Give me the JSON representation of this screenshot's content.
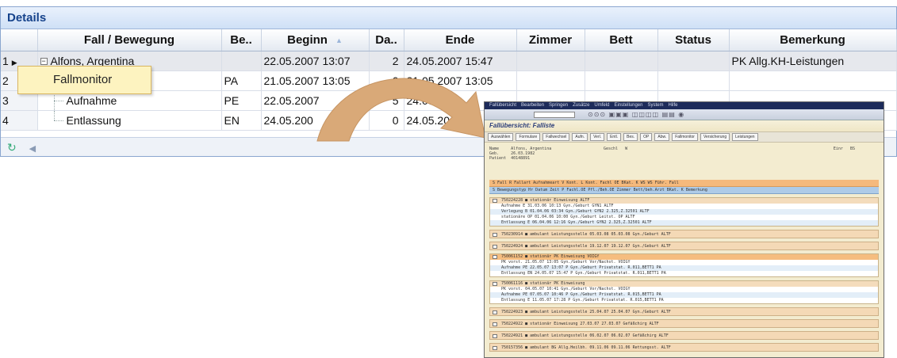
{
  "panel": {
    "title": "Details"
  },
  "columns": {
    "fall": "Fall / Bewegung",
    "be": "Be..",
    "beginn": "Beginn",
    "da": "Da..",
    "ende": "Ende",
    "zimmer": "Zimmer",
    "bett": "Bett",
    "status": "Status",
    "bemerkung": "Bemerkung"
  },
  "rows": [
    {
      "num": "1",
      "fall": "Alfons, Argentina",
      "be": "",
      "beginn": "22.05.2007 13:07",
      "da": "2",
      "ende": "24.05.2007 15:47",
      "zimmer": "",
      "bett": "",
      "status": "",
      "bemerkung": "PK Allg.KH-Leistungen"
    },
    {
      "num": "2",
      "fall": "",
      "be": "PA",
      "beginn": "21.05.2007 13:05",
      "da": "0",
      "ende": "21.05.2007 13:05",
      "zimmer": "",
      "bett": "",
      "status": "",
      "bemerkung": ""
    },
    {
      "num": "3",
      "fall": "Aufnahme",
      "be": "PE",
      "beginn": "22.05.2007",
      "da": "5",
      "ende": "24.05.2",
      "zimmer": "",
      "bett": "",
      "status": "",
      "bemerkung": ""
    },
    {
      "num": "4",
      "fall": "Entlassung",
      "be": "EN",
      "beginn": "24.05.200",
      "da": "0",
      "ende": "24.05.20",
      "zimmer": "",
      "bett": "",
      "status": "",
      "bemerkung": ""
    }
  ],
  "popup": {
    "label": "Fallmonitor"
  },
  "colors": {
    "accent": "#15428b",
    "popup": "#fdf3c0",
    "arrow": "#d9a978",
    "sap_orange": "#f5b97c"
  },
  "sap": {
    "menu": [
      "Fallübersicht",
      "Bearbeiten",
      "Springen",
      "Zusätze",
      "Umfeld",
      "Einstellungen",
      "System",
      "Hilfe"
    ],
    "title": "Fallübersicht: Falliste",
    "toolbar": [
      "Auswählen",
      "Formulare",
      "Fallwechsel",
      "Aufn.",
      "Verl.",
      "Entl.",
      "Bes.",
      "OP",
      "Abw.",
      "Fallmonitor",
      "Versicherung",
      "Leistungen"
    ],
    "header": {
      "name_label": "Name",
      "name": "Alfons, Argentina",
      "geb_label": "Geb.",
      "geb": "26.03.1982",
      "patient_label": "Patient",
      "patient": "40148891",
      "geschl_label": "Geschl",
      "geschl": "W",
      "einr_label": "Einr",
      "einr": "BS"
    },
    "colhead1": "S Fall        R Fallart       Aufnahmeart      V Kont.    L  Kont.  Fachl OE      BKat.  K WS WS   Führ. Fall",
    "colhead2": "S Bewegungstyp  Hr Datum    Zeit  P Fachl.OE     Pfl./Beh.OE  Zimmer Bett/beh.Arzt    BKat.  K  Bemerkung",
    "block1": [
      "750224228   ■ stationär     Einweisung                                                    ALTF",
      "Aufnahme      E  31.03.06 10:13   Gyn./Geburt  GYN1                                       ALTF",
      "Verlegung     B  01.04.06 03:34   Gyn./Geburt  GYN2          2.325,Z.32501                ALTF",
      "stationäre OP    01.04.06 10:00   Gyn./Geburt  Leitst. OP                                 ALTF",
      "Entlassung    E  06.04.06 12:16   Gyn./Geburt  GYN2          2.325,Z.32501                ALTF"
    ],
    "single1": "750230914   ■ ambulant      Leistungsstelle     05.03.08    05.03.08   Gyn./Geburt  ALTF",
    "single2": "750224924   ■ ambulant      Leistungsstelle     19.12.07    19.12.07   Gyn./Geburt  ALTF",
    "block2": [
      "750061152   ■ stationär     PK Einweisung                                                  VOIGY",
      "PK vorst.        21.05.07 13:05   Gyn./Geburt  Vor/Nachst.                                VOIGY",
      "Aufnahme      PE 22.05.07 13:07 P Gyn./Geburt  Privatstat.  R.011,BETT1                   PA",
      "Entlassung    EN 24.05.07 15:47 P Gyn./Geburt  Privatstat.  R.011,BETT1                   PA"
    ],
    "block3": [
      "750061116   ■ stationär     PK Einweisung",
      "PK vorst.        04.05.07 10:41   Gyn./Geburt  Vor/Nachst.                                VOIGY",
      "Aufnahme      PE 07.05.07 10:46 P Gyn./Geburt  Privatstat.  R.015,BETT1                   PA",
      "Entlassung    E  11.05.07 17:28 P Gyn./Geburt  Privatstat.  R.015,BETT1                   PA"
    ],
    "singles": [
      "750224923   ■ ambulant      Leistungsstelle     25.04.07    25.04.07   Gyn./Geburt  ALTF",
      "750224922   ■ stationär     Einweisung          27.03.07    27.03.07   Gefäßchirg  ALTF",
      "750224921   ■ ambulant      Leistungsstelle     06.02.07    06.02.07   Gefäßchirg  ALTF",
      "750157356   ■ ambulant      BG Allg.Heilbh.     09.11.06    09.11.06   Rettungsst.  ALTF"
    ]
  }
}
